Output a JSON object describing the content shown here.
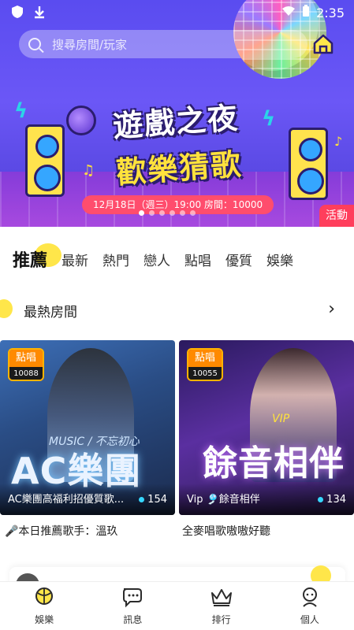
{
  "status_bar": {
    "time": "2:35"
  },
  "search": {
    "placeholder": "搜尋房間/玩家"
  },
  "banner": {
    "title_line1": "遊戲之夜",
    "title_line2": "歡樂猜歌",
    "date_text": "12月18日（週三）19:00  房間：10000",
    "activity_tag": "活動",
    "page_count": 6,
    "active_page": 1
  },
  "tabs": [
    "推薦",
    "最新",
    "熱門",
    "戀人",
    "點唱",
    "優質",
    "娛樂"
  ],
  "active_tab": 0,
  "section": {
    "title": "最熱房間"
  },
  "rooms": [
    {
      "badge_label": "點唱",
      "badge_id": "10088",
      "art_text": "AC樂團",
      "art_sub": "MUSIC / 不忘初心",
      "name": "AC樂團高福利招優質歌...",
      "count": "154",
      "caption": "🎤本日推薦歌手：溫玖"
    },
    {
      "badge_label": "點唱",
      "badge_id": "10055",
      "art_text": "餘音相伴",
      "art_sub": "VIP",
      "name": "Vip 🎐餘音相伴",
      "count": "134",
      "caption": "全麥唱歌嗷嗷好聽"
    }
  ],
  "bottom_nav": [
    {
      "label": "娛樂",
      "icon": "ball-icon"
    },
    {
      "label": "訊息",
      "icon": "chat-icon"
    },
    {
      "label": "排行",
      "icon": "crown-icon"
    },
    {
      "label": "個人",
      "icon": "profile-icon"
    }
  ],
  "colors": {
    "accent_yellow": "#ffe64a",
    "tag_red": "#ff3e5c",
    "count_dot": "#36d7ff"
  }
}
